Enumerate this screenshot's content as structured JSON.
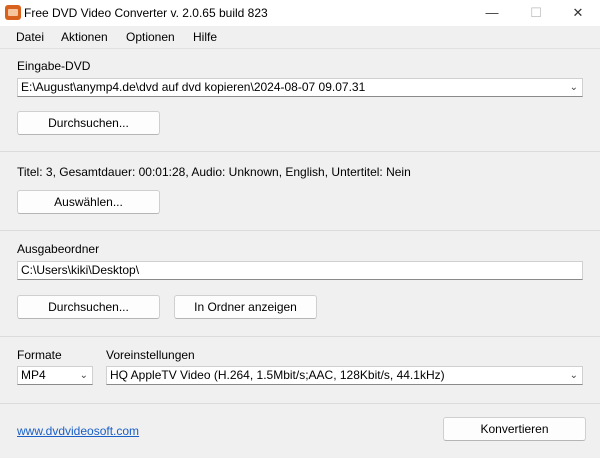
{
  "window": {
    "title": "Free DVD Video Converter  v. 2.0.65 build 823",
    "min": "—",
    "max": "☐",
    "close": "✕"
  },
  "menu": [
    "Datei",
    "Aktionen",
    "Optionen",
    "Hilfe"
  ],
  "input_dvd": {
    "label": "Eingabe-DVD",
    "value": "E:\\August\\anymp4.de\\dvd auf dvd kopieren\\2024-08-07 09.07.31",
    "browse_label": "Durchsuchen..."
  },
  "info": {
    "text": "Titel: 3, Gesamtdauer: 00:01:28, Audio: Unknown, English, Untertitel: Nein",
    "select_label": "Auswählen..."
  },
  "output": {
    "label": "Ausgabeordner",
    "value": "C:\\Users\\kiki\\Desktop\\",
    "browse_label": "Durchsuchen...",
    "show_folder_label": "In Ordner anzeigen"
  },
  "format": {
    "label": "Formate",
    "value": "MP4"
  },
  "preset": {
    "label": "Voreinstellungen",
    "value": "HQ AppleTV Video (H.264, 1.5Mbit/s;AAC, 128Kbit/s, 44.1kHz)"
  },
  "footer": {
    "link": "www.dvdvideosoft.com",
    "convert_label": "Konvertieren"
  }
}
